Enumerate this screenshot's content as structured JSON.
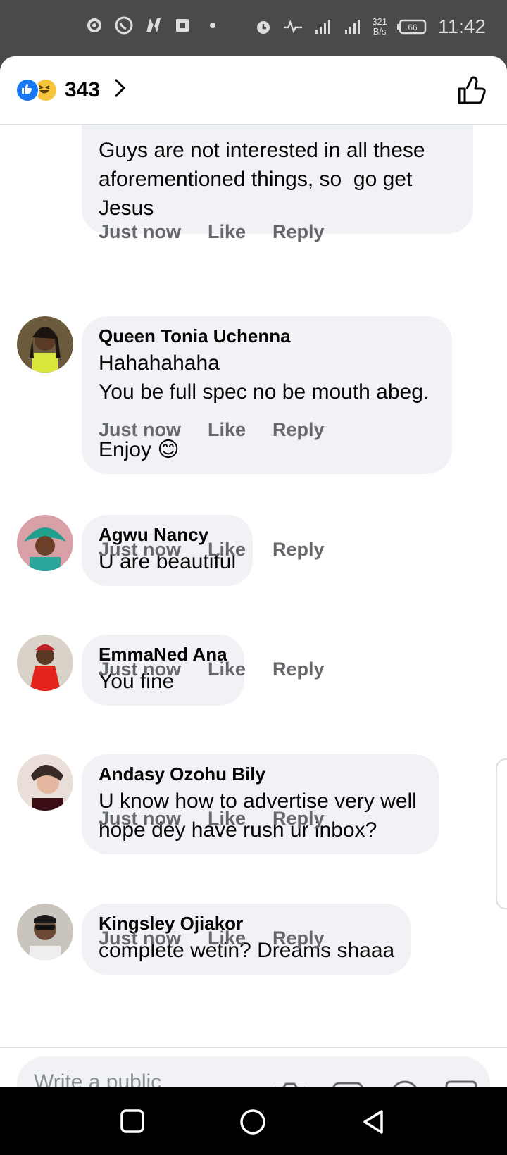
{
  "status_bar": {
    "time": "11:42",
    "net_speed_value": "321",
    "net_speed_unit": "B/s",
    "battery": "66",
    "network": "4G",
    "icons": [
      "settings-icon",
      "whatsapp-icon",
      "n-app-icon",
      "pdf-icon",
      "dot-icon",
      "alarm-icon",
      "activity-icon",
      "signal-icon",
      "signal-4g-icon",
      "battery-icon"
    ]
  },
  "header": {
    "reaction_count": "343",
    "reactions": [
      "like",
      "haha"
    ]
  },
  "comments": [
    {
      "author": "",
      "text": "Guys are not interested in all these aforementioned things, so  go get Jesus",
      "time": "Just now",
      "like": "Like",
      "reply": "Reply"
    },
    {
      "author": "Queen Tonia Uchenna",
      "text": "Hahahahaha\nYou be full spec no be mouth abeg.\n\nEnjoy 😊",
      "time": "Just now",
      "like": "Like",
      "reply": "Reply"
    },
    {
      "author": "Agwu Nancy",
      "text": "U are beautiful",
      "time": "Just now",
      "like": "Like",
      "reply": "Reply"
    },
    {
      "author": "EmmaNed Ana",
      "text": "You fine",
      "time": "Just now",
      "like": "Like",
      "reply": "Reply"
    },
    {
      "author": "Andasy Ozohu Bily",
      "text": "U know how to advertise very well hope dey have rush ur inbox?",
      "time": "Just now",
      "like": "Like",
      "reply": "Reply"
    },
    {
      "author": "Kingsley Ojiakor",
      "text": "complete wetin? Dreams shaaa",
      "time": "Just now",
      "like": "Like",
      "reply": "Reply"
    }
  ],
  "composer": {
    "placeholder": "Write a public comment...",
    "icons": [
      "camera-icon",
      "gif-icon",
      "emoji-icon",
      "sticker-icon"
    ]
  },
  "colors": {
    "accent": "#1877f2",
    "bubble": "#f0f2f5",
    "meta_text": "#65676b",
    "status_bar": "#4a4a4a"
  }
}
